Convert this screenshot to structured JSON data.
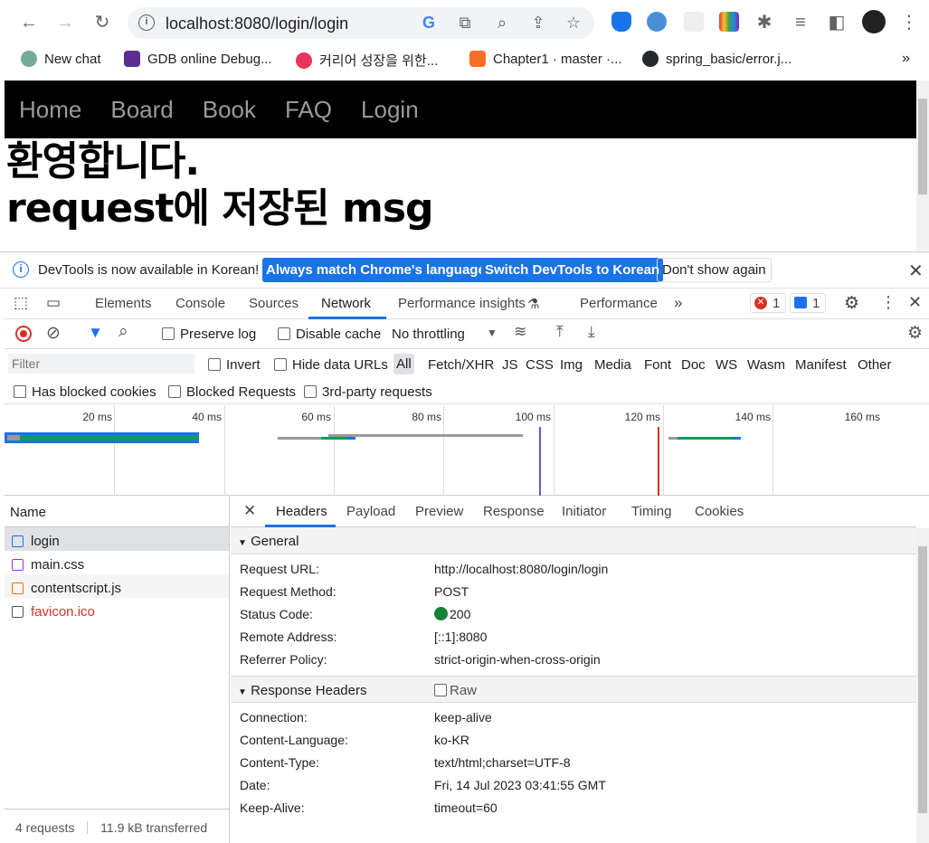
{
  "browser": {
    "url": "localhost:8080/login/login",
    "bookmarks": [
      {
        "label": "New chat",
        "icon": "openai-icon"
      },
      {
        "label": "GDB online Debug...",
        "icon": "gdb-icon"
      },
      {
        "label": "커리어 성장을 위한...",
        "icon": "career-icon"
      },
      {
        "label": "Chapter1 · master ·...",
        "icon": "gitlab-icon"
      },
      {
        "label": "spring_basic/error.j...",
        "icon": "github-icon"
      }
    ],
    "overflow": "»"
  },
  "page": {
    "nav": [
      "Home",
      "Board",
      "Book",
      "FAQ",
      "Login"
    ],
    "heading1": "환영합니다.",
    "heading2": "request에 저장된 msg"
  },
  "devtools": {
    "infobar": {
      "message": "DevTools is now available in Korean!",
      "btn_match": "Always match Chrome's language",
      "btn_switch": "Switch DevTools to Korean",
      "btn_dismiss": "Don't show again"
    },
    "tabs": [
      "Elements",
      "Console",
      "Sources",
      "Network",
      "Performance insights",
      "Performance"
    ],
    "active_tab": "Network",
    "error_count": "1",
    "message_count": "1",
    "toolbar": {
      "preserve_log": "Preserve log",
      "disable_cache": "Disable cache",
      "throttling": "No throttling"
    },
    "filter": {
      "placeholder": "Filter",
      "invert": "Invert",
      "hide_data_urls": "Hide data URLs",
      "types": [
        "All",
        "Fetch/XHR",
        "JS",
        "CSS",
        "Img",
        "Media",
        "Font",
        "Doc",
        "WS",
        "Wasm",
        "Manifest",
        "Other"
      ],
      "has_blocked_cookies": "Has blocked cookies",
      "blocked_requests": "Blocked Requests",
      "third_party": "3rd-party requests"
    },
    "timeline_ticks": [
      "20 ms",
      "40 ms",
      "60 ms",
      "80 ms",
      "100 ms",
      "120 ms",
      "140 ms",
      "160 ms"
    ],
    "requests": {
      "header": "Name",
      "items": [
        "login",
        "main.css",
        "contentscript.js",
        "favicon.ico"
      ],
      "footer_count": "4 requests",
      "footer_size": "11.9 kB transferred"
    },
    "details": {
      "tabs": [
        "Headers",
        "Payload",
        "Preview",
        "Response",
        "Initiator",
        "Timing",
        "Cookies"
      ],
      "general_title": "General",
      "general": [
        {
          "k": "Request URL:",
          "v": "http://localhost:8080/login/login"
        },
        {
          "k": "Request Method:",
          "v": "POST"
        },
        {
          "k": "Status Code:",
          "v": "200"
        },
        {
          "k": "Remote Address:",
          "v": "[::1]:8080"
        },
        {
          "k": "Referrer Policy:",
          "v": "strict-origin-when-cross-origin"
        }
      ],
      "response_title": "Response Headers",
      "raw_label": "Raw",
      "response": [
        {
          "k": "Connection:",
          "v": "keep-alive"
        },
        {
          "k": "Content-Language:",
          "v": "ko-KR"
        },
        {
          "k": "Content-Type:",
          "v": "text/html;charset=UTF-8"
        },
        {
          "k": "Date:",
          "v": "Fri, 14 Jul 2023 03:41:55 GMT"
        },
        {
          "k": "Keep-Alive:",
          "v": "timeout=60"
        }
      ]
    }
  }
}
